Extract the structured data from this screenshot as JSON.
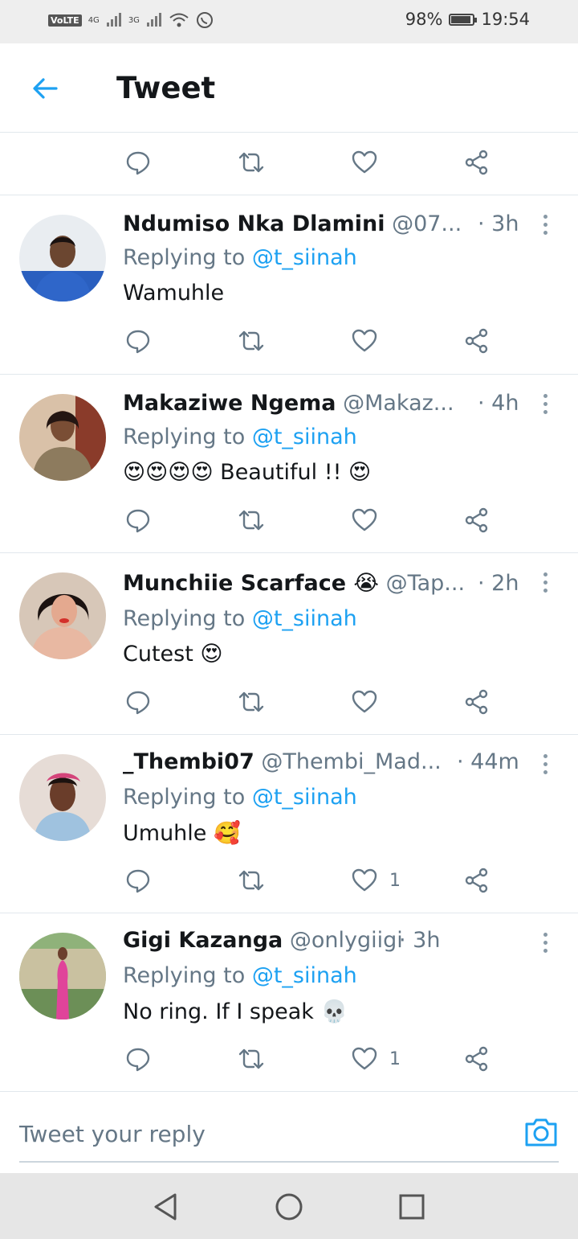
{
  "status": {
    "volte": "VoLTE",
    "net1": "4G",
    "net2": "3G",
    "battery": "98%",
    "time": "19:54"
  },
  "header": {
    "title": "Tweet"
  },
  "tweets": [
    {
      "name": "Ndumiso Nka Dlamini",
      "handle": "@07...",
      "time": "· 3h",
      "reply_prefix": "Replying to ",
      "reply_to": "@t_siinah",
      "text": "Wamuhle",
      "likes": ""
    },
    {
      "name": "Makaziwe Ngema",
      "handle": "@Makaz...",
      "time": "· 4h",
      "reply_prefix": "Replying to ",
      "reply_to": "@t_siinah",
      "text": "😍😍😍😍 Beautiful !! 😍",
      "likes": ""
    },
    {
      "name": "Munchiie Scarface 😭",
      "handle": "@Tap...",
      "time": "· 2h",
      "reply_prefix": "Replying to ",
      "reply_to": "@t_siinah",
      "text": "Cutest 😍",
      "likes": ""
    },
    {
      "name": "_Thembi07",
      "handle": "@Thembi_Mad...",
      "time": "· 44m",
      "reply_prefix": "Replying to ",
      "reply_to": "@t_siinah",
      "text": "Umuhle 🥰",
      "likes": "1"
    },
    {
      "name": "Gigi Kazanga",
      "handle": "@onlygiigi",
      "time": "· 3h",
      "reply_prefix": "Replying to ",
      "reply_to": "@t_siinah",
      "text": "No ring. If I speak 💀",
      "likes": "1"
    }
  ],
  "reply_bar": {
    "placeholder": "Tweet your reply"
  },
  "colors": {
    "accent": "#1da1f2",
    "secondary_text": "#657786",
    "divider": "#e1e8ed"
  }
}
